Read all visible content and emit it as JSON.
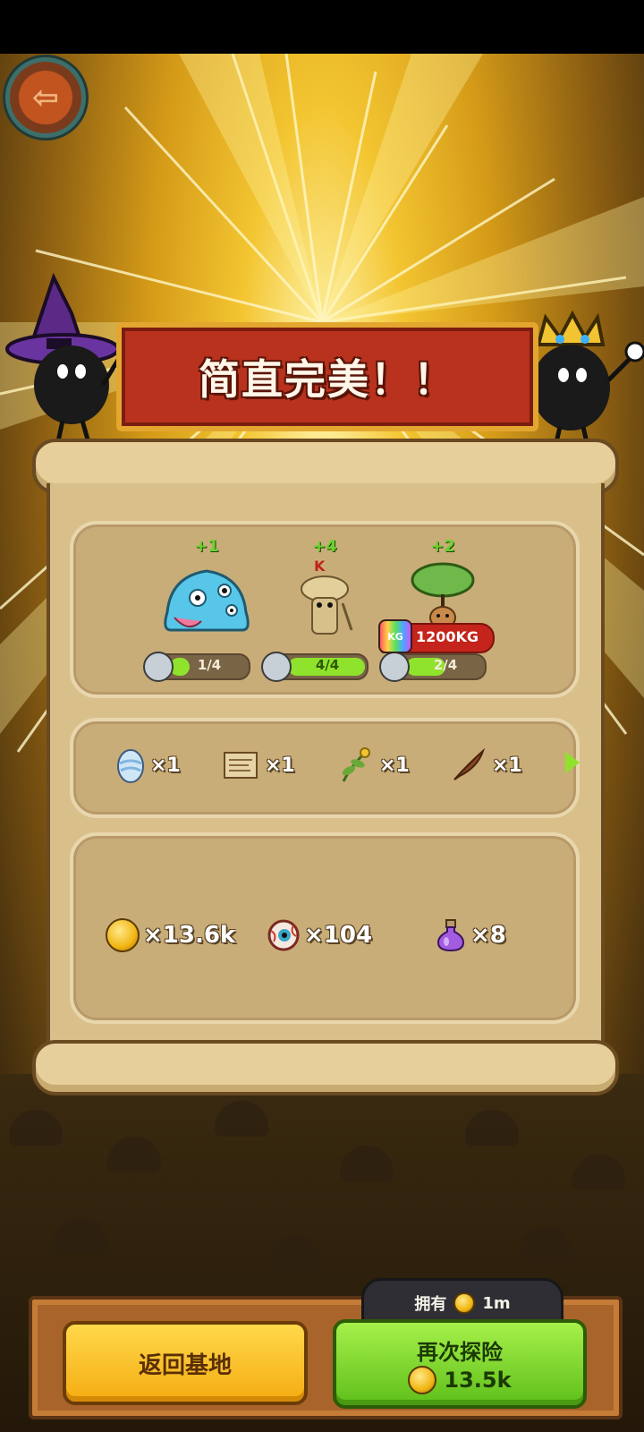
{
  "banner": {
    "title": "简直完美！！"
  },
  "monsters": [
    {
      "plus": "+1",
      "progress_label": "1/4",
      "progress": 0.25,
      "color": "#58c6e8"
    },
    {
      "plus": "+4",
      "progress_label": "4/4",
      "progress": 1.0,
      "color": "#d8c08a"
    },
    {
      "plus": "+2",
      "progress_label": "2/4",
      "progress": 0.5,
      "color": "#6fb84a",
      "weight": "1200KG"
    }
  ],
  "weight_badge": "KG",
  "items": [
    {
      "icon": "egg-icon",
      "count": "×1"
    },
    {
      "icon": "scroll-map-icon",
      "count": "×1"
    },
    {
      "icon": "herb-icon",
      "count": "×1"
    },
    {
      "icon": "feather-icon",
      "count": "×1"
    }
  ],
  "rewards": [
    {
      "icon": "coin-icon",
      "count": "×13.6k"
    },
    {
      "icon": "eyeball-icon",
      "count": "×104"
    },
    {
      "icon": "potion-icon",
      "count": "×8"
    }
  ],
  "footer": {
    "home_label": "返回基地",
    "again_label": "再次探险",
    "again_cost": "13.5k",
    "owned_label": "拥有",
    "owned_value": "1m"
  }
}
